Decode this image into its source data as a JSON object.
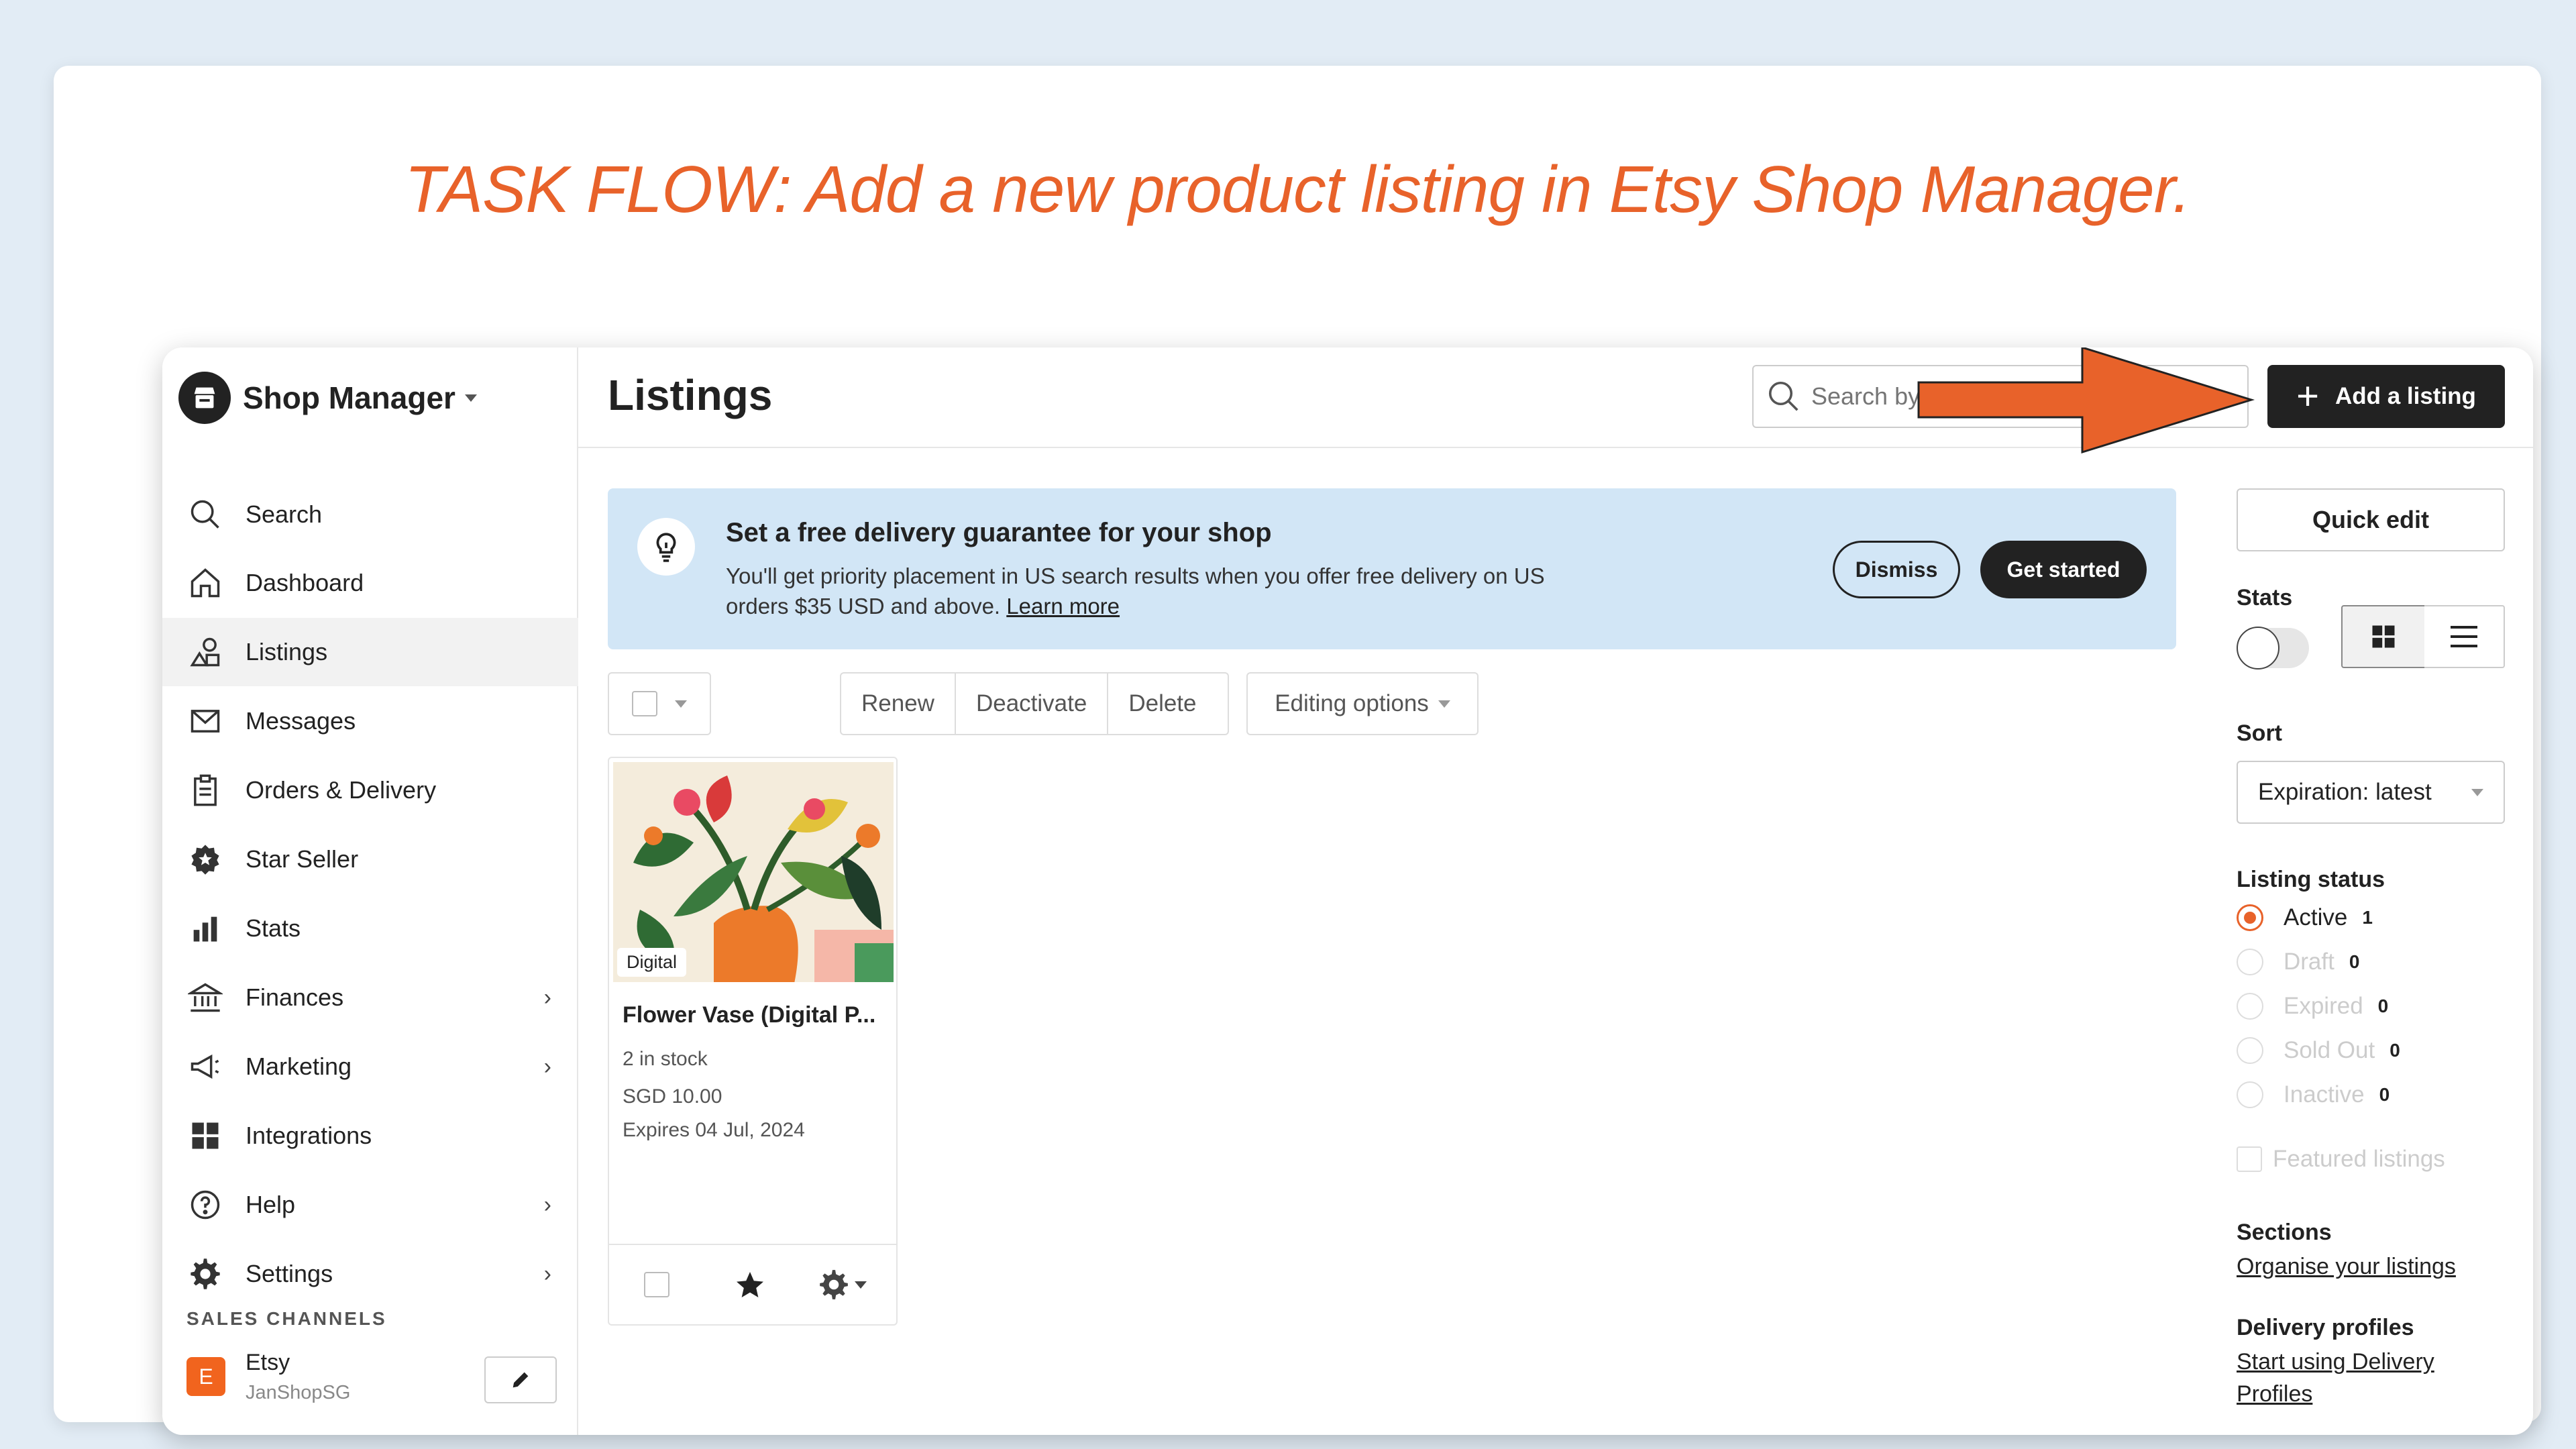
{
  "task_title": "TASK FLOW: Add a new product listing in Etsy Shop Manager.",
  "sidebar": {
    "title": "Shop Manager",
    "items": [
      {
        "label": "Search",
        "icon": "search-icon"
      },
      {
        "label": "Dashboard",
        "icon": "home-icon"
      },
      {
        "label": "Listings",
        "icon": "shapes-icon",
        "active": true
      },
      {
        "label": "Messages",
        "icon": "mail-icon"
      },
      {
        "label": "Orders & Delivery",
        "icon": "clipboard-icon"
      },
      {
        "label": "Star Seller",
        "icon": "star-badge-icon"
      },
      {
        "label": "Stats",
        "icon": "bar-chart-icon"
      },
      {
        "label": "Finances",
        "icon": "bank-icon",
        "chevron": true
      },
      {
        "label": "Marketing",
        "icon": "megaphone-icon",
        "chevron": true
      },
      {
        "label": "Integrations",
        "icon": "grid-icon"
      },
      {
        "label": "Help",
        "icon": "help-icon",
        "chevron": true
      },
      {
        "label": "Settings",
        "icon": "gear-icon",
        "chevron": true
      }
    ],
    "sales_channels_label": "SALES CHANNELS",
    "channel": {
      "badge": "E",
      "name": "Etsy",
      "shop": "JanShopSG"
    }
  },
  "header": {
    "title": "Listings",
    "search_placeholder": "Search by",
    "add_button": "Add a listing"
  },
  "banner": {
    "title": "Set a free delivery guarantee for your shop",
    "text": "You'll get priority placement in US search results when you offer free delivery on US orders $35 USD and above.",
    "link": "Learn more",
    "dismiss": "Dismiss",
    "get_started": "Get started"
  },
  "toolbar": {
    "renew": "Renew",
    "deactivate": "Deactivate",
    "delete": "Delete",
    "editing_options": "Editing options"
  },
  "listing": {
    "tag": "Digital",
    "name": "Flower Vase (Digital P...",
    "stock": "2 in stock",
    "price": "SGD 10.00",
    "expires": "Expires 04 Jul, 2024"
  },
  "right_panel": {
    "quick_edit": "Quick edit",
    "stats_label": "Stats",
    "sort_label": "Sort",
    "sort_value": "Expiration: latest",
    "status_label": "Listing status",
    "statuses": [
      {
        "label": "Active",
        "count": "1",
        "selected": true
      },
      {
        "label": "Draft",
        "count": "0"
      },
      {
        "label": "Expired",
        "count": "0"
      },
      {
        "label": "Sold Out",
        "count": "0"
      },
      {
        "label": "Inactive",
        "count": "0"
      }
    ],
    "featured": "Featured listings",
    "sections_label": "Sections",
    "sections_link": "Organise your listings",
    "delivery_label": "Delivery profiles",
    "delivery_link": "Start using Delivery Profiles"
  },
  "colors": {
    "accent": "#e8622a",
    "banner": "#d2e6f6",
    "dark": "#222222"
  }
}
